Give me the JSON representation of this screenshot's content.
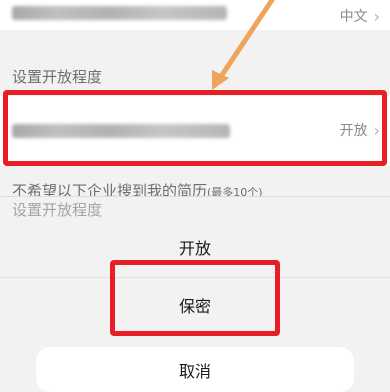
{
  "settings": {
    "language_row": {
      "value": "中文",
      "chevron": "chevron-right-icon"
    },
    "section_label": "设置开放程度",
    "privacy_row": {
      "value": "开放",
      "chevron": "chevron-right-icon"
    },
    "note_text": "不希望以下企业搜到我的简历",
    "note_small": "(最多10个)"
  },
  "action_sheet": {
    "title": "设置开放程度",
    "options": [
      "开放",
      "保密"
    ],
    "cancel_label": "取消"
  },
  "colors": {
    "highlight_red": "#e61e26",
    "arrow_orange": "#f0a35a"
  }
}
